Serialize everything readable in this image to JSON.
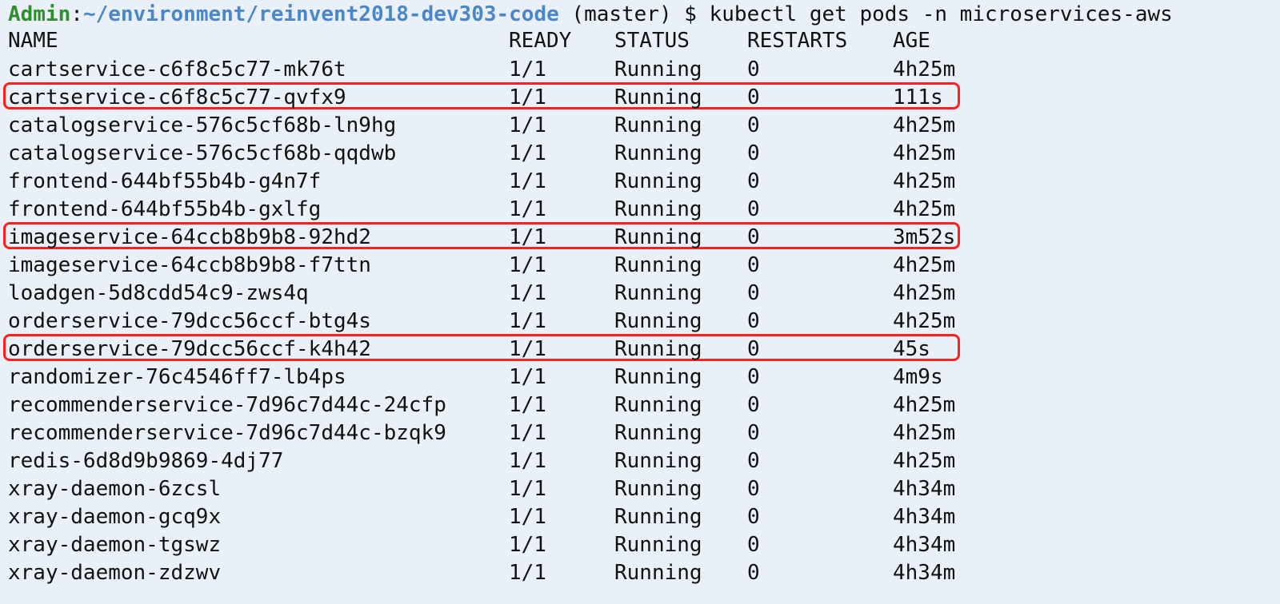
{
  "prompt": {
    "user": "Admin",
    "sep": ":",
    "path": "~/environment/reinvent2018-dev303-code",
    "rest": " (master) $ kubectl get pods -n microservices-aws"
  },
  "table": {
    "headers": [
      "NAME",
      "READY",
      "STATUS",
      "RESTARTS",
      "AGE"
    ],
    "rows": [
      {
        "name": "cartservice-c6f8c5c77-mk76t",
        "ready": "1/1",
        "status": "Running",
        "restarts": "0",
        "age": "4h25m",
        "highlighted": false
      },
      {
        "name": "cartservice-c6f8c5c77-qvfx9",
        "ready": "1/1",
        "status": "Running",
        "restarts": "0",
        "age": "111s",
        "highlighted": true
      },
      {
        "name": "catalogservice-576c5cf68b-ln9hg",
        "ready": "1/1",
        "status": "Running",
        "restarts": "0",
        "age": "4h25m",
        "highlighted": false
      },
      {
        "name": "catalogservice-576c5cf68b-qqdwb",
        "ready": "1/1",
        "status": "Running",
        "restarts": "0",
        "age": "4h25m",
        "highlighted": false
      },
      {
        "name": "frontend-644bf55b4b-g4n7f",
        "ready": "1/1",
        "status": "Running",
        "restarts": "0",
        "age": "4h25m",
        "highlighted": false
      },
      {
        "name": "frontend-644bf55b4b-gxlfg",
        "ready": "1/1",
        "status": "Running",
        "restarts": "0",
        "age": "4h25m",
        "highlighted": false
      },
      {
        "name": "imageservice-64ccb8b9b8-92hd2",
        "ready": "1/1",
        "status": "Running",
        "restarts": "0",
        "age": "3m52s",
        "highlighted": true
      },
      {
        "name": "imageservice-64ccb8b9b8-f7ttn",
        "ready": "1/1",
        "status": "Running",
        "restarts": "0",
        "age": "4h25m",
        "highlighted": false
      },
      {
        "name": "loadgen-5d8cdd54c9-zws4q",
        "ready": "1/1",
        "status": "Running",
        "restarts": "0",
        "age": "4h25m",
        "highlighted": false
      },
      {
        "name": "orderservice-79dcc56ccf-btg4s",
        "ready": "1/1",
        "status": "Running",
        "restarts": "0",
        "age": "4h25m",
        "highlighted": false
      },
      {
        "name": "orderservice-79dcc56ccf-k4h42",
        "ready": "1/1",
        "status": "Running",
        "restarts": "0",
        "age": "45s",
        "highlighted": true
      },
      {
        "name": "randomizer-76c4546ff7-lb4ps",
        "ready": "1/1",
        "status": "Running",
        "restarts": "0",
        "age": "4m9s",
        "highlighted": false
      },
      {
        "name": "recommenderservice-7d96c7d44c-24cfp",
        "ready": "1/1",
        "status": "Running",
        "restarts": "0",
        "age": "4h25m",
        "highlighted": false
      },
      {
        "name": "recommenderservice-7d96c7d44c-bzqk9",
        "ready": "1/1",
        "status": "Running",
        "restarts": "0",
        "age": "4h25m",
        "highlighted": false
      },
      {
        "name": "redis-6d8d9b9869-4dj77",
        "ready": "1/1",
        "status": "Running",
        "restarts": "0",
        "age": "4h25m",
        "highlighted": false
      },
      {
        "name": "xray-daemon-6zcsl",
        "ready": "1/1",
        "status": "Running",
        "restarts": "0",
        "age": "4h34m",
        "highlighted": false
      },
      {
        "name": "xray-daemon-gcq9x",
        "ready": "1/1",
        "status": "Running",
        "restarts": "0",
        "age": "4h34m",
        "highlighted": false
      },
      {
        "name": "xray-daemon-tgswz",
        "ready": "1/1",
        "status": "Running",
        "restarts": "0",
        "age": "4h34m",
        "highlighted": false
      },
      {
        "name": "xray-daemon-zdzwv",
        "ready": "1/1",
        "status": "Running",
        "restarts": "0",
        "age": "4h34m",
        "highlighted": false
      }
    ]
  },
  "colors": {
    "background": "#eaf0f8",
    "prompt_user": "#2f8f2f",
    "prompt_path": "#4a86c8",
    "highlight_border": "#ff2020"
  }
}
